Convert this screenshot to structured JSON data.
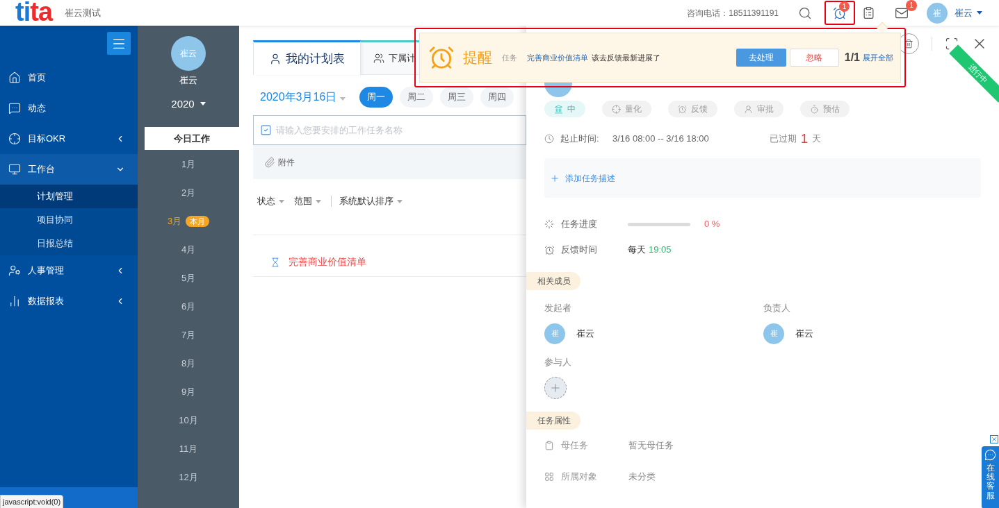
{
  "header": {
    "logo": [
      {
        "text": "ti",
        "color": "#1a7bd6"
      },
      {
        "text": "ta",
        "color": "#ee2a2a"
      }
    ],
    "company": "崔云测试",
    "phone": "咨询电话：18511391191",
    "alarm_badge": "1",
    "alarm_highlighted": true,
    "mail_badge": "1",
    "avatar": "崔",
    "user": "崔云"
  },
  "sidebar": {
    "items": [
      {
        "label": "首页",
        "expandable": false
      },
      {
        "label": "动态",
        "expandable": false
      },
      {
        "label": "目标OKR",
        "expandable": true,
        "expanded": false
      },
      {
        "label": "工作台",
        "expandable": true,
        "expanded": true,
        "children": [
          {
            "label": "计划管理",
            "selected": true
          },
          {
            "label": "项目协同",
            "selected": false
          },
          {
            "label": "日报总结",
            "selected": false
          }
        ]
      },
      {
        "label": "人事管理",
        "expandable": true,
        "expanded": false
      },
      {
        "label": "数据报表",
        "expandable": true,
        "expanded": false
      }
    ]
  },
  "status_tooltip": "javascript:void(0)",
  "calendar": {
    "avatar": "崔云",
    "name": "崔云",
    "year": "2020",
    "today": {
      "label": "今日工作",
      "selected": true
    },
    "months": [
      {
        "label": "1月",
        "current": false
      },
      {
        "label": "2月",
        "current": false
      },
      {
        "label": "3月",
        "current": true,
        "badge": "本月"
      },
      {
        "label": "4月",
        "current": false
      },
      {
        "label": "5月",
        "current": false
      },
      {
        "label": "6月",
        "current": false
      },
      {
        "label": "7月",
        "current": false
      },
      {
        "label": "8月",
        "current": false
      },
      {
        "label": "9月",
        "current": false
      },
      {
        "label": "10月",
        "current": false
      },
      {
        "label": "11月",
        "current": false
      },
      {
        "label": "12月",
        "current": false
      }
    ]
  },
  "main": {
    "tabs": [
      {
        "label": "我的计划表",
        "selected": true
      },
      {
        "label": "下属计",
        "selected": false
      }
    ],
    "date": "2020年3月16日",
    "days": [
      {
        "label": "周一",
        "selected": true
      },
      {
        "label": "周二",
        "selected": false
      },
      {
        "label": "周三",
        "selected": false
      },
      {
        "label": "周四",
        "selected": false
      }
    ],
    "task_input": {
      "placeholder": "请输入您要安排的工作任务名称"
    },
    "attachment": "附件",
    "filters": [
      {
        "label": "状态",
        "kind": "dropdown"
      },
      {
        "label": "范围",
        "kind": "dropdown"
      },
      {
        "kind": "divider"
      },
      {
        "label": "系统默认排序",
        "kind": "dropdown"
      }
    ],
    "tasks": [
      {
        "title": "完善商业价值清单"
      }
    ]
  },
  "detail": {
    "status_ribbon": "进行中",
    "tags": [
      {
        "label": "中",
        "active": true
      },
      {
        "label": "量化",
        "active": false
      },
      {
        "label": "反馈",
        "active": false
      },
      {
        "label": "审批",
        "active": false
      },
      {
        "label": "预估",
        "active": false
      }
    ],
    "time_label": "起止时间:",
    "time_range": "3/16 08:00 -- 3/16 18:00",
    "overdue_prefix": "已过期",
    "overdue_days": "1",
    "overdue_suffix": "天",
    "add_description": "添加任务描述",
    "progress": {
      "label": "任务进度",
      "level": 0,
      "reading": "0 %"
    },
    "feedback": {
      "label": "反馈时间",
      "freq": "每天",
      "time": "19:05"
    },
    "members_section": "相关成员",
    "initiator": {
      "label": "发起者",
      "avatar": "崔",
      "name": "崔云"
    },
    "owner": {
      "label": "负责人",
      "avatar": "崔",
      "name": "崔云"
    },
    "participants_label": "参与人",
    "attributes_section": "任务属性",
    "attributes": [
      {
        "label": "母任务",
        "value": "暂无母任务"
      },
      {
        "label": "所属对象",
        "value": "未分类"
      }
    ]
  },
  "reminder": {
    "highlighted": true,
    "title": "提醒",
    "type": "任务",
    "task_link": "完善商业价值清单",
    "message": "该去反馈最新进展了",
    "primary_button": "去处理",
    "ignore_button": "忽略",
    "count": "1/1",
    "expand_link": "展开全部"
  },
  "chat_widget": {
    "label": "在线客服"
  }
}
